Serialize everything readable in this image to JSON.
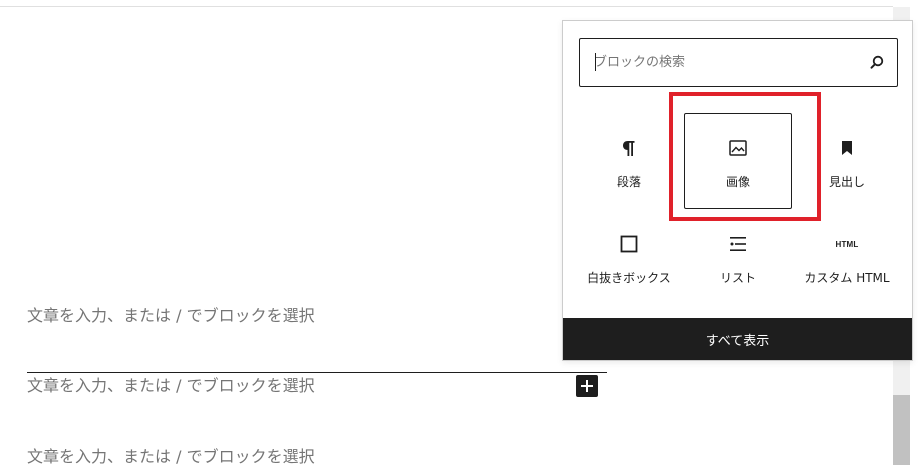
{
  "editor": {
    "placeholders": [
      "文章を入力、または / でブロックを選択",
      "文章を入力、または / でブロックを選択",
      "文章を入力、または / でブロックを選択"
    ]
  },
  "inserter": {
    "search": {
      "placeholder": "ブロックの検索",
      "value": ""
    },
    "blocks": [
      {
        "label": "段落",
        "icon": "paragraph-icon"
      },
      {
        "label": "画像",
        "icon": "image-icon"
      },
      {
        "label": "見出し",
        "icon": "heading-bookmark-icon"
      },
      {
        "label": "白抜きボックス",
        "icon": "square-outline-icon"
      },
      {
        "label": "リスト",
        "icon": "list-icon"
      },
      {
        "label": "カスタム HTML",
        "icon": "html-icon",
        "icon_text": "HTML"
      }
    ],
    "show_all_label": "すべて表示"
  },
  "colors": {
    "highlight_frame": "#e0212a",
    "dark": "#1e1e1e",
    "placeholder_text": "#757575"
  }
}
